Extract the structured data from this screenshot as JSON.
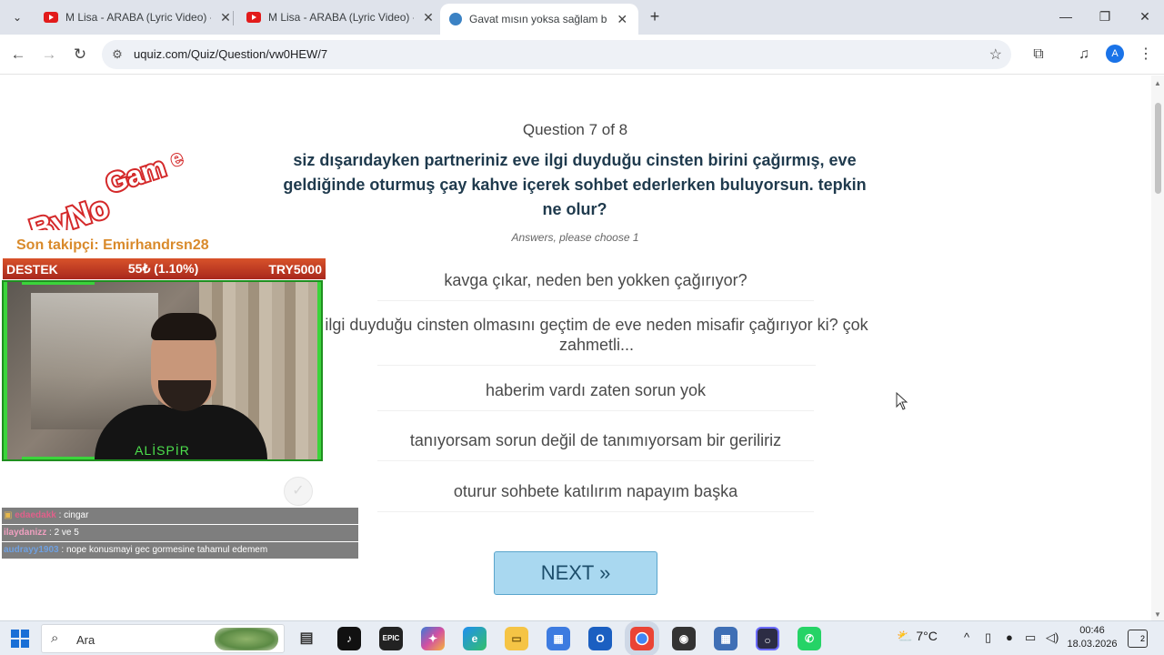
{
  "browser": {
    "tabs": [
      {
        "title": "M Lisa - ARABA (Lyric Video) - YouTube",
        "favicon": "youtube-icon",
        "active": false
      },
      {
        "title": "M Lisa - ARABA (Lyric Video) - YouTube",
        "favicon": "youtube-icon",
        "active": false
      },
      {
        "title": "Gavat mısın yoksa sağlam bir gav",
        "favicon": "uquiz-icon",
        "active": true
      }
    ],
    "url": "uquiz.com/Quiz/Question/vw0HEW/7",
    "profile_initial": "A"
  },
  "quiz": {
    "counter": "Question 7 of 8",
    "question": "siz dışarıdayken partneriniz eve ilgi duyduğu cinsten birini çağırmış, eve geldiğinde oturmuş çay kahve içerek sohbet ederlerken buluyorsun. tepkin ne olur?",
    "hint": "Answers, please choose 1",
    "answers": [
      "kavga çıkar, neden ben yokken çağırıyor?",
      "ilgi duyduğu cinsten olmasını geçtim de eve neden misafir çağırıyor ki? çok zahmetli...",
      "haberim vardı zaten sorun yok",
      "tanıyorsam sorun değil de tanımıyorsam bir geriliriz",
      "oturur sohbete katılırım napayım başka"
    ],
    "next_label": "NEXT »"
  },
  "overlay": {
    "logo_text": "ByNo Game",
    "follower": "Son takipçi: Emirhandrsn28",
    "destek": {
      "label": "DESTEK",
      "amount": "55₺ (1.10%)",
      "goal": "TRY5000"
    },
    "cam_label": "ALİSPİR",
    "chat": [
      {
        "user": "edaedakk",
        "message": ": cingar",
        "user_color": "#e0608a",
        "has_badge": true
      },
      {
        "user": "ilaydanizz",
        "message": ": 2 ve 5",
        "user_color": "#f0a0c0",
        "has_badge": false
      },
      {
        "user": "audrayy1903",
        "message": ": nope konusmayi gec gormesine tahamul edemem",
        "user_color": "#6fa0e0",
        "has_badge": false
      }
    ]
  },
  "taskbar": {
    "search_placeholder": "Ara",
    "weather": "7°C",
    "time": "00:46",
    "date": "18.03.2026",
    "notifications": "2"
  }
}
